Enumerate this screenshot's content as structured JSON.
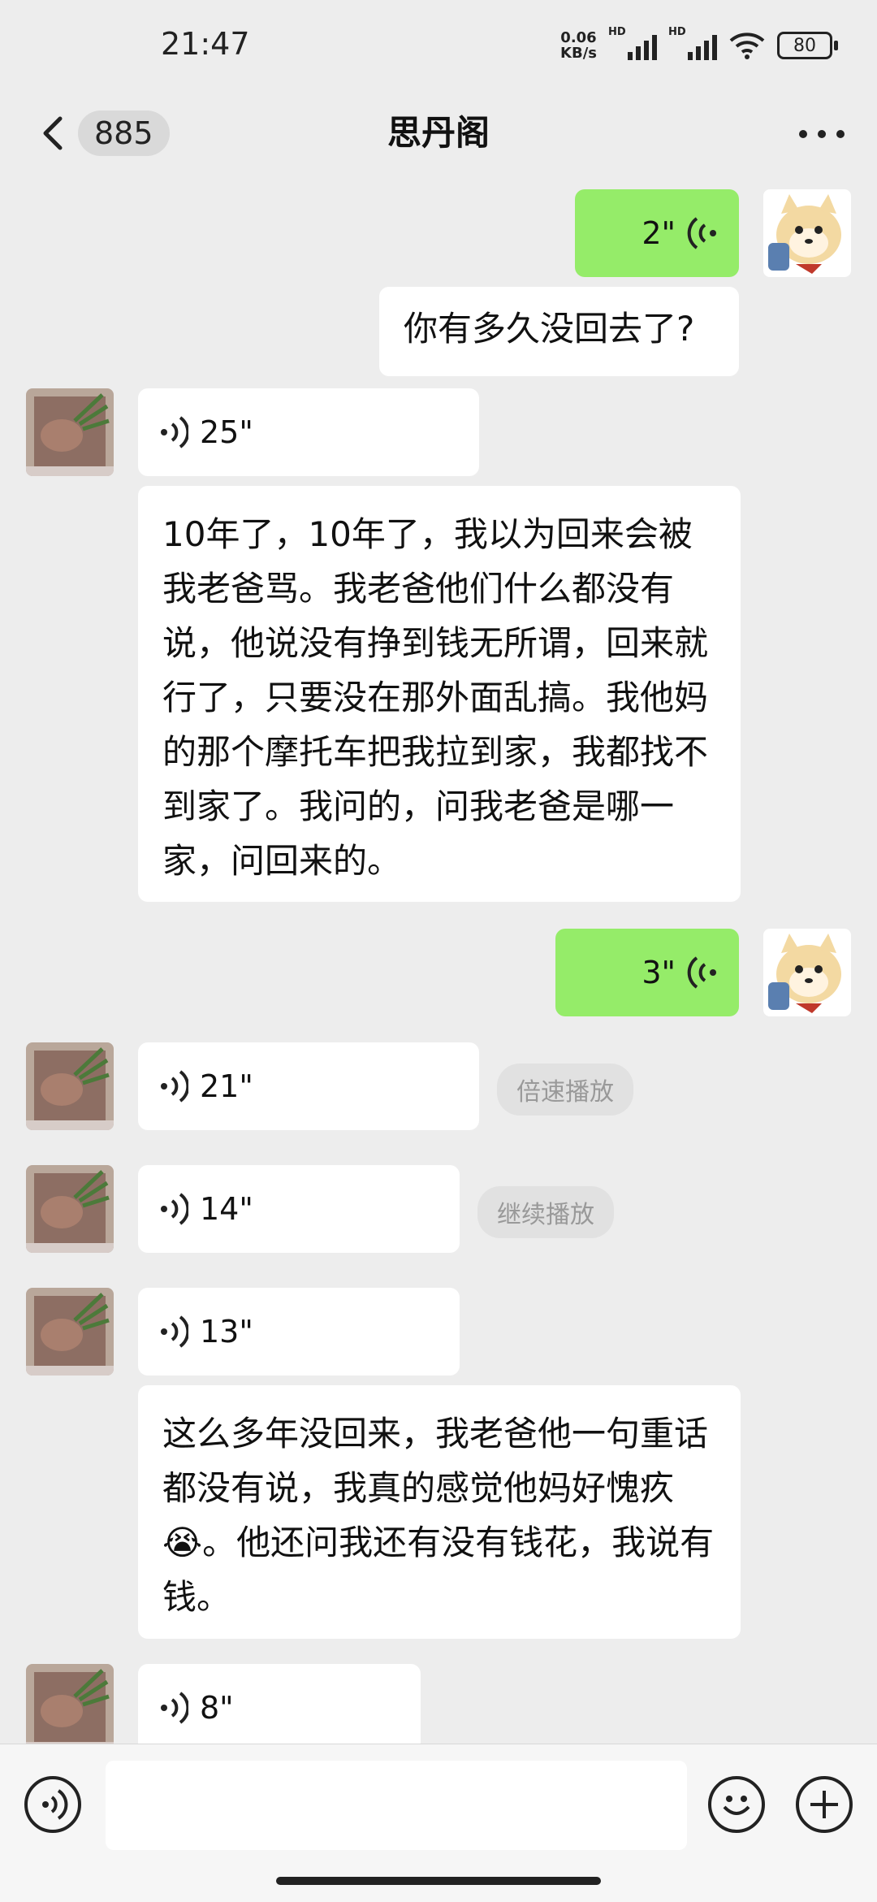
{
  "status": {
    "time": "21:47",
    "net_speed_value": "0.06",
    "net_speed_unit": "KB/s",
    "hd_label": "HD",
    "battery": "80"
  },
  "nav": {
    "unread_count": "885",
    "title": "思丹阁"
  },
  "messages": [
    {
      "side": "out",
      "type": "voice",
      "duration": "2\""
    },
    {
      "side": "out",
      "type": "text",
      "text": "你有多久没回去了?"
    },
    {
      "side": "in",
      "type": "voice",
      "duration": "25\""
    },
    {
      "side": "in",
      "type": "text",
      "text": "10年了，10年了，我以为回来会被我老爸骂。我老爸他们什么都没有说，他说没有挣到钱无所谓，回来就行了，只要没在那外面乱搞。我他妈的那个摩托车把我拉到家，我都找不到家了。我问的，问我老爸是哪一家，问回来的。"
    },
    {
      "side": "out",
      "type": "voice",
      "duration": "3\""
    },
    {
      "side": "in",
      "type": "voice",
      "duration": "21\"",
      "tag": "倍速播放"
    },
    {
      "side": "in",
      "type": "voice",
      "duration": "14\"",
      "tag": "继续播放"
    },
    {
      "side": "in",
      "type": "voice",
      "duration": "13\""
    },
    {
      "side": "in",
      "type": "text",
      "text": "这么多年没回来，我老爸他一句重话都没有说，我真的感觉他妈好愧疚😭。他还问我还有没有钱花，我说有钱。"
    },
    {
      "side": "in",
      "type": "voice",
      "duration": "8\""
    }
  ],
  "input": {
    "placeholder": ""
  },
  "colors": {
    "background": "#ededed",
    "outgoing_bubble": "#95ec69",
    "incoming_bubble": "#ffffff"
  },
  "icons": [
    "back-chevron-icon",
    "more-dots-icon",
    "voice-mode-icon",
    "emoji-icon",
    "plus-icon",
    "voice-wave-icon",
    "sticker-avatar",
    "contact-avatar"
  ]
}
